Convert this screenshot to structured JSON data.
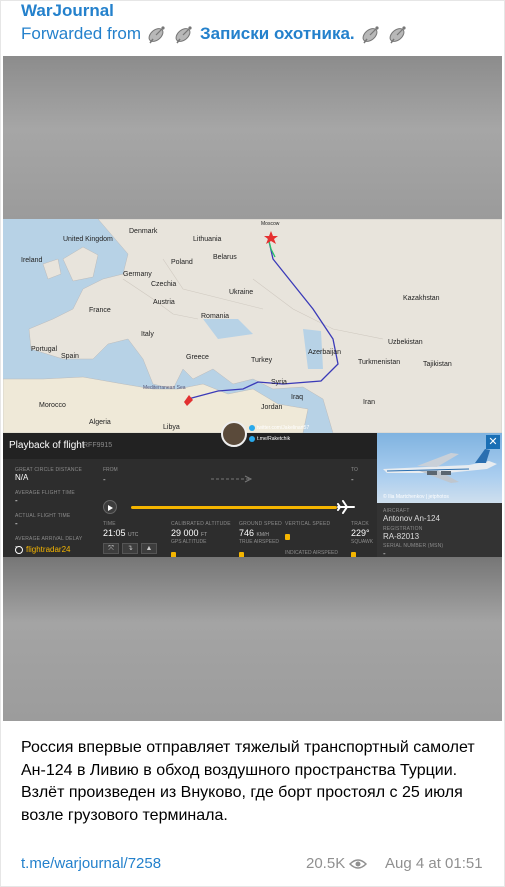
{
  "header": {
    "channel_name": "WarJournal",
    "forwarded_prefix": "Forwarded from",
    "forwarded_source": "Записки охотника."
  },
  "map": {
    "labels": {
      "united_kingdom": "United Kingdom",
      "ireland": "Ireland",
      "denmark": "Denmark",
      "lithuania": "Lithuania",
      "germany": "Germany",
      "poland": "Poland",
      "belarus": "Belarus",
      "france": "France",
      "czechia": "Czechia",
      "ukraine": "Ukraine",
      "austria": "Austria",
      "romania": "Romania",
      "italy": "Italy",
      "portugal": "Portugal",
      "spain": "Spain",
      "greece": "Greece",
      "turkey": "Turkey",
      "azerbaijan": "Azerbaijan",
      "turkmenistan": "Turkmenistan",
      "uzbekistan": "Uzbekistan",
      "kazakhstan": "Kazakhstan",
      "tajikistan": "Tajikistan",
      "syria": "Syria",
      "iraq": "Iraq",
      "iran": "Iran",
      "jordan": "Jordan",
      "algeria": "Algeria",
      "morocco": "Morocco",
      "libya": "Libya",
      "moscow": "Moscow",
      "mediterranean": "Mediterranean Sea"
    },
    "social": {
      "twitter": "twitter.com/Jakelinart57",
      "telegram": "t.me/Raketchik"
    }
  },
  "playback": {
    "title": "Playback of flight",
    "flight_id": "RFF9915",
    "left": {
      "great_circle_label": "GREAT CIRCLE DISTANCE",
      "great_circle_value": "N/A",
      "avg_flight_time_label": "AVERAGE FLIGHT TIME",
      "avg_flight_time_value": "-",
      "actual_flight_time_label": "ACTUAL FLIGHT TIME",
      "actual_flight_time_value": "-",
      "avg_arrival_delay_label": "AVERAGE ARRIVAL DELAY",
      "avg_arrival_delay_value": "-"
    },
    "logo": "flightradar24",
    "from_label": "FROM",
    "from_value": "-",
    "to_label": "TO",
    "to_value": "-",
    "stats": {
      "time_label": "TIME",
      "time_value": "21:05",
      "time_unit": "UTC",
      "altitude_label": "CALIBRATED ALTITUDE",
      "altitude_value": "29 000",
      "altitude_unit": "FT",
      "gps_altitude_label": "GPS ALTITUDE",
      "ground_speed_label": "GROUND SPEED",
      "ground_speed_value": "746",
      "ground_speed_unit": "KM/H",
      "true_airspeed_label": "TRUE AIRSPEED",
      "vertical_speed_label": "VERTICAL SPEED",
      "indicated_airspeed_label": "INDICATED AIRSPEED",
      "track_label": "TRACK",
      "track_value": "229°",
      "squawk_label": "SQUAWK"
    },
    "aircraft_label": "AIRCRAFT",
    "aircraft_value": "Antonov An-124",
    "registration_label": "REGISTRATION",
    "registration_value": "RA-82013",
    "serial_label": "SERIAL NUMBER (MSN)",
    "serial_value": "-",
    "photo_credit": "© Ilia Martchenkov | jetphotos"
  },
  "caption": "Россия впервые отправляет тяжелый транспортный самолет Ан-124 в Ливию в обход воздушного пространства Турции. Взлёт произведен из Внуково, где борт простоял с 25 июля возле грузового терминала.",
  "footer": {
    "link": "t.me/warjournal/7258",
    "views": "20.5K",
    "time": "Aug 4 at 01:51"
  },
  "colors": {
    "accent": "#2481cc",
    "route": "#3a3ab8",
    "fr24_yellow": "#f5b500"
  }
}
